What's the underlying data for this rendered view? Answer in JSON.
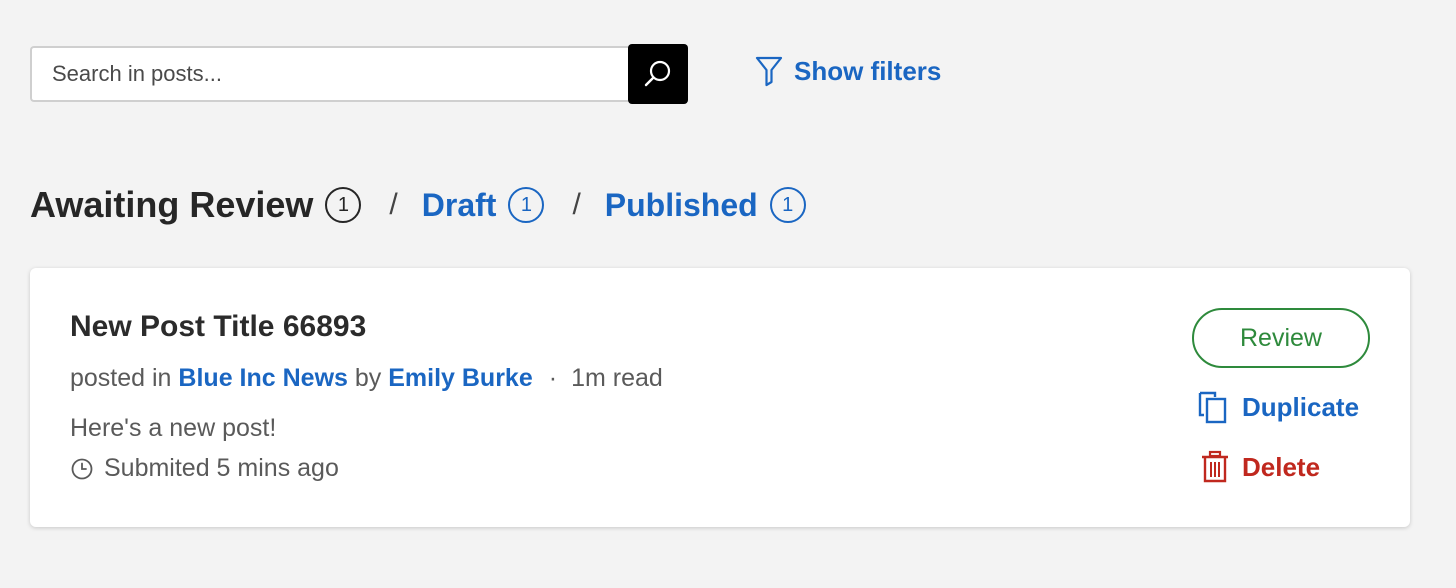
{
  "search": {
    "placeholder": "Search in posts...",
    "value": ""
  },
  "filters": {
    "label": "Show filters"
  },
  "tabs": [
    {
      "label": "Awaiting Review",
      "count": "1",
      "active": true
    },
    {
      "label": "Draft",
      "count": "1",
      "active": false
    },
    {
      "label": "Published",
      "count": "1",
      "active": false
    }
  ],
  "separator": "/",
  "post": {
    "title": "New Post Title 66893",
    "posted_in_prefix": "posted in",
    "publication": "Blue Inc News",
    "by": "by",
    "author": "Emily Burke",
    "dot": "·",
    "read_time": "1m read",
    "excerpt": "Here's a new post!",
    "submitted": "Submited 5 mins ago"
  },
  "actions": {
    "review": "Review",
    "duplicate": "Duplicate",
    "delete": "Delete"
  },
  "colors": {
    "link": "#1a66c2",
    "review": "#2e8a3c",
    "delete": "#c0281e",
    "background": "#f3f3f3"
  }
}
